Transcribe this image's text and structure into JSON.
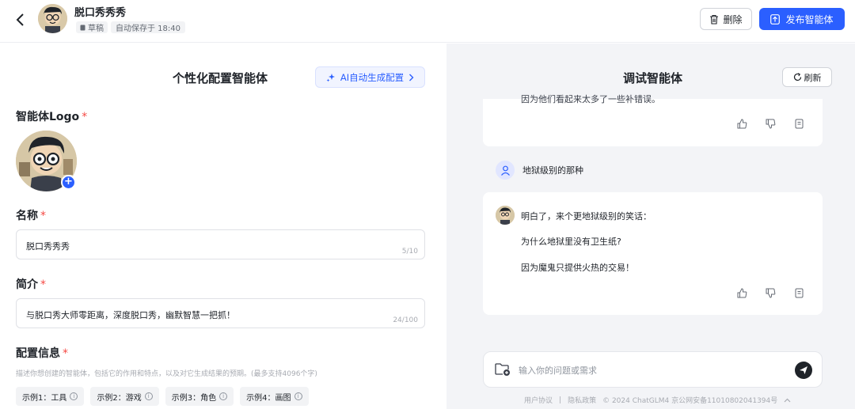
{
  "header": {
    "title": "脱口秀秀秀",
    "status_badge": "草稿",
    "autosave": "自动保存于 18:40",
    "delete_label": "删除",
    "publish_label": "发布智能体"
  },
  "config": {
    "title": "个性化配置智能体",
    "ai_button": "AI自动生成配置",
    "logo_label": "智能体Logo",
    "name_label": "名称",
    "name_value": "脱口秀秀秀",
    "name_count": "5/10",
    "intro_label": "简介",
    "intro_value": "与脱口秀大师零距离，深度脱口秀，幽默智慧一把抓！",
    "intro_count": "24/100",
    "info_label": "配置信息",
    "info_hint": "描述你想创建的智能体，包括它的作用和特点，以及对它生成结果的预期。(最多支持4096个字)",
    "examples": [
      "示例1：工具",
      "示例2：游戏",
      "示例3：角色",
      "示例4：画图"
    ],
    "required_mark": "*"
  },
  "debug": {
    "title": "调试智能体",
    "refresh_label": "刷新",
    "partial_text": "因为他们看起来太多了一些补错误。",
    "user_message": "地狱级别的那种",
    "bot_reply": [
      "明白了，来个更地狱级别的笑话：",
      "为什么地狱里没有卫生纸?",
      "因为魔鬼只提供火热的交易！"
    ],
    "input_placeholder": "输入你的问题或需求"
  },
  "footer": {
    "user_agreement": "用户协议",
    "privacy": "隐私政策",
    "copyright": "© 2024 ChatGLM4 京公网安备11010802041394号",
    "separator": "|"
  },
  "colors": {
    "accent": "#2b5fff",
    "required": "#f54a45"
  }
}
